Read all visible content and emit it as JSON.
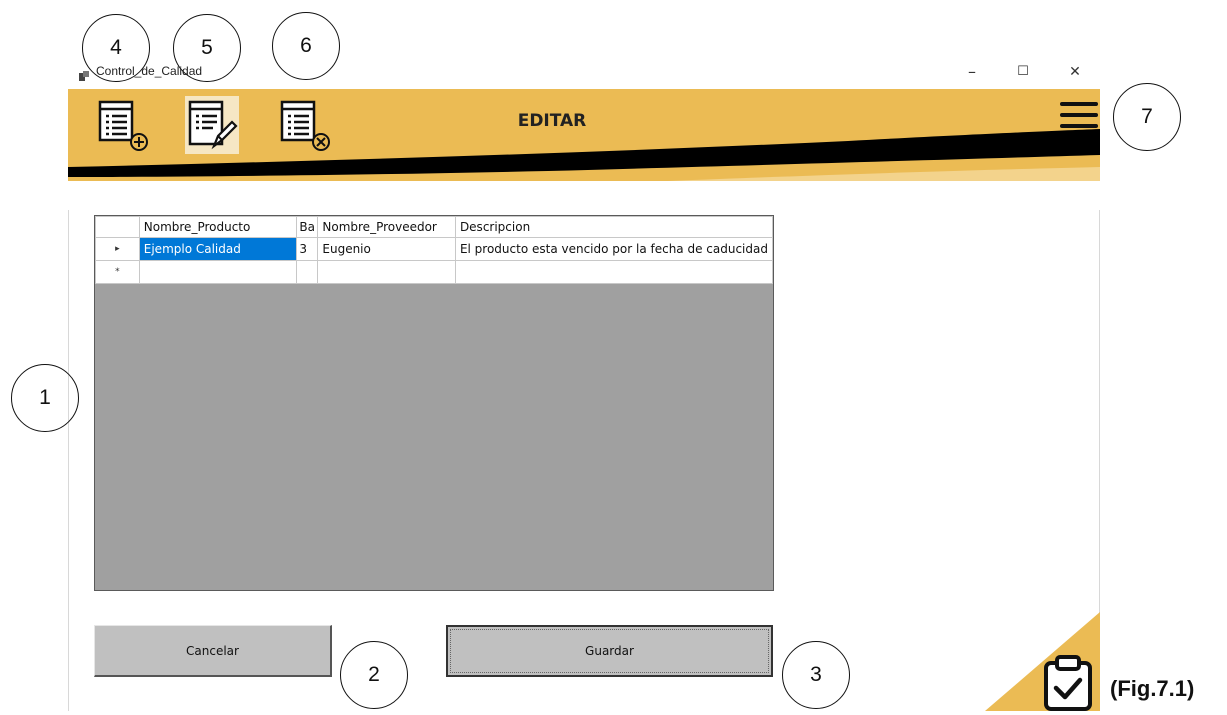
{
  "window": {
    "title": "Control_de_Calidad",
    "minimize": "–",
    "maximize": "☐",
    "close": "✕"
  },
  "header": {
    "title": "EDITAR",
    "accent_color": "#ebbb54",
    "dark_color": "#000000",
    "icons": [
      "list-add-icon",
      "list-edit-icon",
      "list-delete-icon",
      "hamburger-menu-icon"
    ]
  },
  "grid": {
    "columns": [
      "Nombre_Producto",
      "Ba",
      "Nombre_Proveedor",
      "Descripcion"
    ],
    "rows": [
      {
        "indicator": "▸",
        "cells": [
          "Ejemplo Calidad",
          "3",
          "Eugenio",
          "El producto esta vencido por la fecha de caducidad"
        ]
      },
      {
        "indicator": "*",
        "cells": [
          "",
          "",
          "",
          ""
        ]
      }
    ],
    "selected_color": "#0078d7"
  },
  "buttons": {
    "cancel": "Cancelar",
    "save": "Guardar"
  },
  "annotations": [
    "1",
    "2",
    "3",
    "4",
    "5",
    "6",
    "7"
  ],
  "caption": "(Fig.7.1)"
}
